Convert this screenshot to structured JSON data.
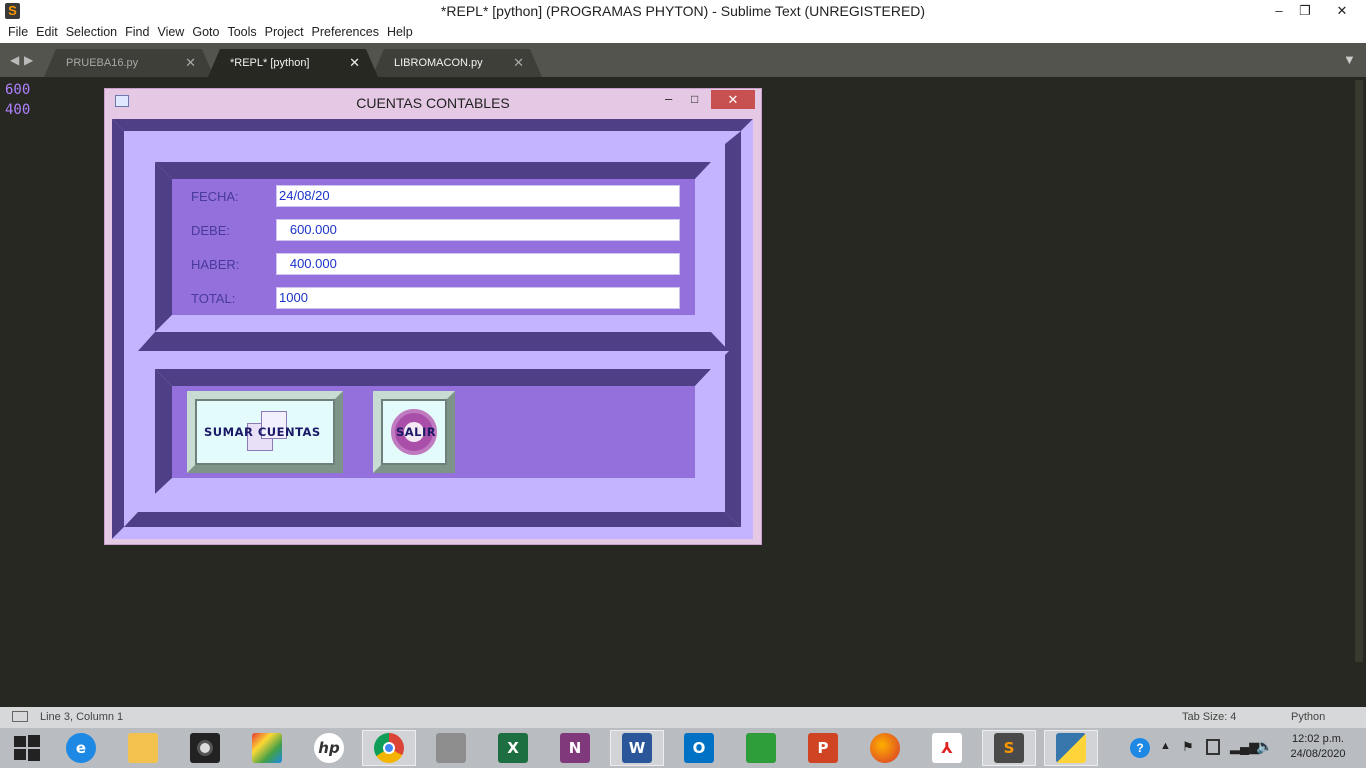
{
  "window": {
    "title": "*REPL* [python] (PROGRAMAS  PHYTON) - Sublime Text (UNREGISTERED)",
    "controls": [
      "–",
      "❐",
      "✕"
    ]
  },
  "menu": [
    "File",
    "Edit",
    "Selection",
    "Find",
    "View",
    "Goto",
    "Tools",
    "Project",
    "Preferences",
    "Help"
  ],
  "tabs": [
    {
      "label": "PRUEBA16.py",
      "active": false
    },
    {
      "label": "*REPL* [python]",
      "active": true
    },
    {
      "label": "LIBROMACON.py",
      "active": false
    }
  ],
  "editor": {
    "lines": [
      "600",
      "400"
    ]
  },
  "status": {
    "position": "Line 3, Column 1",
    "tab_size": "Tab Size: 4",
    "syntax": "Python"
  },
  "dialog": {
    "title": "CUENTAS CONTABLES",
    "fields": [
      {
        "label": "FECHA:",
        "value": "24/08/20"
      },
      {
        "label": "DEBE:",
        "value": "   600.000"
      },
      {
        "label": "HABER:",
        "value": "   400.000"
      },
      {
        "label": "TOTAL:",
        "value": "1000"
      }
    ],
    "buttons": {
      "sumar": "SUMAR CUENTAS",
      "salir": "SALIR"
    },
    "colors": {
      "outer": "#4e3f86",
      "middle": "#c4b4ff",
      "inner": "#9370db"
    }
  },
  "taskbar": {
    "clock_time": "12:02 p.m.",
    "clock_date": "24/08/2020",
    "apps": [
      "windows-start",
      "internet-explorer",
      "file-explorer",
      "webcam",
      "paint",
      "hp",
      "chrome",
      "bricks",
      "excel",
      "onenote",
      "word",
      "outlook",
      "store",
      "powerpoint",
      "firefox",
      "acrobat",
      "sublime",
      "python"
    ],
    "app_letters": {
      "excel": "X",
      "onenote": "N",
      "word": "W",
      "outlook": "O",
      "powerpoint": "P",
      "sublime": "S"
    }
  }
}
